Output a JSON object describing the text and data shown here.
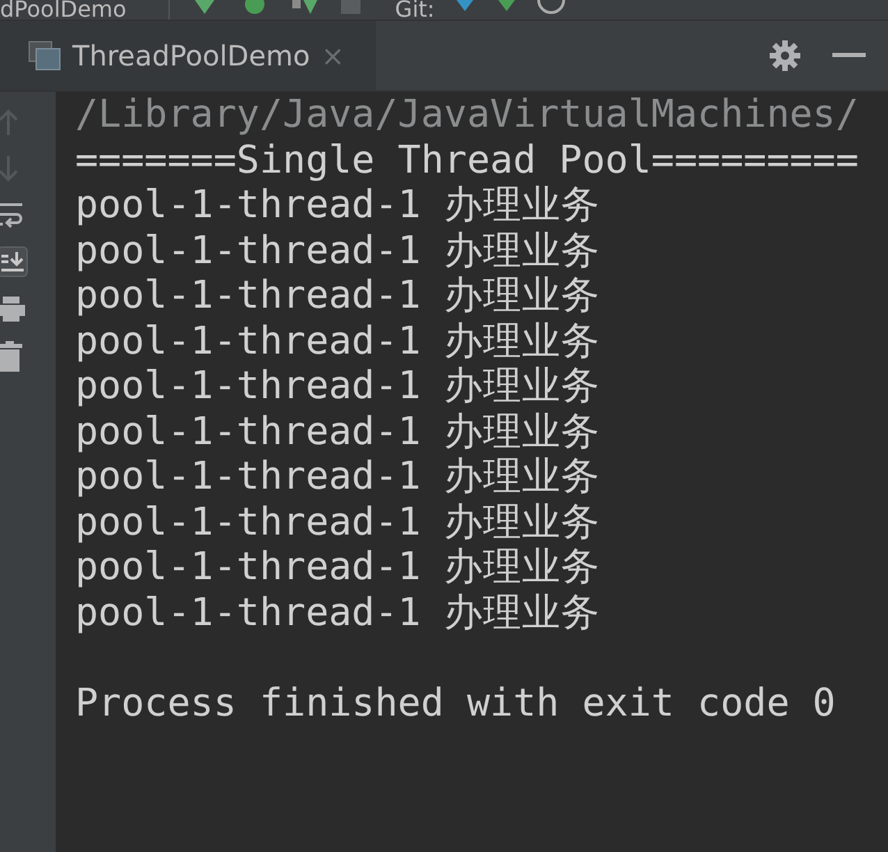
{
  "toolbar": {
    "config_label": "dPoolDemo",
    "vcs_label": "Git:"
  },
  "tab": {
    "title": "ThreadPoolDemo",
    "close": "×"
  },
  "console": {
    "lines": [
      "/Library/Java/JavaVirtualMachines/",
      "=======Single Thread Pool=========",
      "pool-1-thread-1 办理业务",
      "pool-1-thread-1 办理业务",
      "pool-1-thread-1 办理业务",
      "pool-1-thread-1 办理业务",
      "pool-1-thread-1 办理业务",
      "pool-1-thread-1 办理业务",
      "pool-1-thread-1 办理业务",
      "pool-1-thread-1 办理业务",
      "pool-1-thread-1 办理业务",
      "pool-1-thread-1 办理业务"
    ],
    "exit_message": "Process finished with exit code 0"
  }
}
